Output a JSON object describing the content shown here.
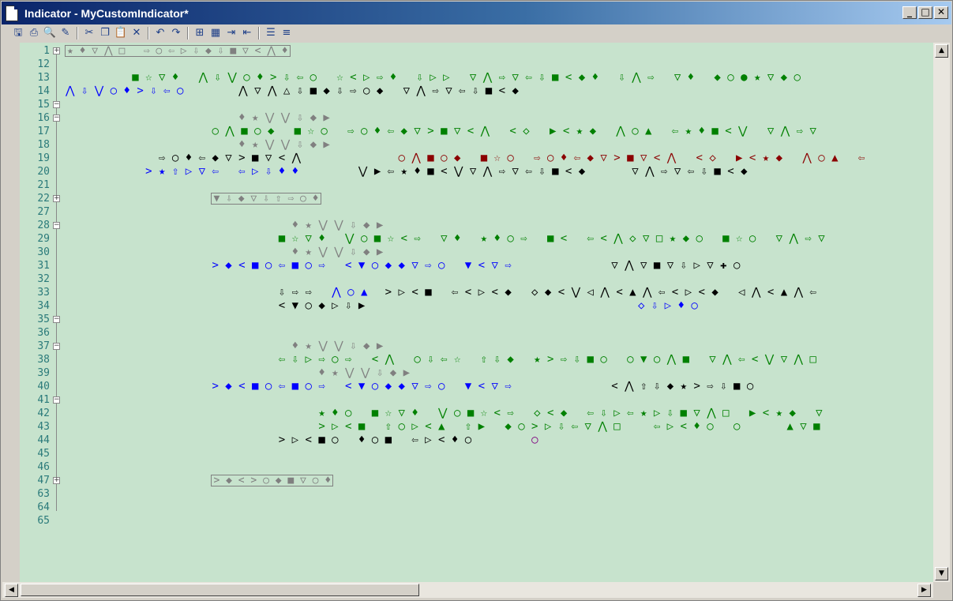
{
  "window": {
    "title": "Indicator - MyCustomIndicator*"
  },
  "window_buttons": [
    "_",
    "□",
    "✕"
  ],
  "toolbar": {
    "groups": [
      [
        "save-icon",
        "print-icon",
        "print-preview-icon",
        "find-icon"
      ],
      [
        "cut-icon",
        "copy-icon",
        "paste-icon",
        "delete-icon"
      ],
      [
        "undo-icon",
        "redo-icon"
      ],
      [
        "binoculars-icon",
        "replace-icon",
        "indent-icon",
        "outdent-icon"
      ],
      [
        "comment-icon",
        "uncomment-icon"
      ]
    ],
    "glyphs": {
      "save-icon": "🖫",
      "print-icon": "⎙",
      "print-preview-icon": "🔍",
      "find-icon": "✎",
      "cut-icon": "✂",
      "copy-icon": "❐",
      "paste-icon": "📋",
      "delete-icon": "✕",
      "undo-icon": "↶",
      "redo-icon": "↷",
      "binoculars-icon": "⊞",
      "replace-icon": "▦",
      "indent-icon": "⇥",
      "outdent-icon": "⇤",
      "comment-icon": "☰",
      "uncomment-icon": "≡"
    }
  },
  "editor": {
    "line_numbers": [
      "1",
      "12",
      "13",
      "14",
      "15",
      "16",
      "17",
      "18",
      "19",
      "20",
      "21",
      "22",
      "27",
      "28",
      "29",
      "30",
      "31",
      "32",
      "33",
      "34",
      "35",
      "36",
      "37",
      "38",
      "39",
      "40",
      "41",
      "42",
      "43",
      "44",
      "45",
      "46",
      "47",
      "63",
      "64",
      "65"
    ],
    "lines": [
      {
        "ln": "1",
        "collapsed": true,
        "text": "★ ♦ ▽ ⋀ □   ⇨ ○ ⇦ ▷ ⇩ ◆ ⇩ ■ ▽ < ⋀ ♦",
        "indent": 0
      },
      {
        "ln": "12",
        "segments": []
      },
      {
        "ln": "13",
        "segments": [
          {
            "col": 5,
            "color": "green",
            "text": "■ ☆ ▽ ♦   ⋀ ⇩ ⋁ ○ ♦ > ⇩ ⇦ ○   ☆ < ▷ ⇨ ♦   ⇩ ▷ ▷   ▽ ⋀ ⇨ ▽ ⇦ ⇩ ■ < ◆ ♦   ⇩ ⋀ ⇨   ▽ ♦   ◆ ○ ● ★ ▽ ◆ ○"
          }
        ]
      },
      {
        "ln": "14",
        "segments": [
          {
            "col": 0,
            "color": "blue",
            "text": "⋀ ⇩ ⋁ ○ ♦ > ⇩ ⇦ ○"
          },
          {
            "col": 13,
            "color": "black",
            "text": "⋀ ▽ ⋀ △ ⇩ ■ ◆ ⇩ ⇨ ○ ◆   ▽ ⋀ ⇨ ▽ ⇦ ⇩ ■ < ◆"
          }
        ]
      },
      {
        "ln": "15",
        "segments": []
      },
      {
        "ln": "16",
        "segments": [
          {
            "col": 13,
            "color": "gray",
            "text": "♦ ★ ⋁ ⋁ ⇩ ◆ ▶"
          }
        ]
      },
      {
        "ln": "17",
        "segments": [
          {
            "col": 11,
            "color": "green",
            "text": "○ ⋀ ■ ○ ◆   ■ ☆ ○   ⇨ ○ ♦ ⇦ ◆ ▽ > ■ ▽ < ⋀   < ◇   ▶ < ★ ◆   ⋀ ○ ▲   ⇦ ★ ♦ ■ < ⋁   ▽ ⋀ ⇨ ▽"
          }
        ]
      },
      {
        "ln": "18",
        "segments": [
          {
            "col": 13,
            "color": "gray",
            "text": "♦ ★ ⋁ ⋁ ⇩ ◆ ▶"
          }
        ]
      },
      {
        "ln": "19",
        "segments": [
          {
            "col": 7,
            "color": "black",
            "text": "⇨ ○ ♦ ⇦ ◆ ▽ > ■ ▽ < ⋀"
          },
          {
            "col": 25,
            "color": "red",
            "text": "○ ⋀ ■ ○ ◆   ■ ☆ ○   ⇨ ○ ♦ ⇦ ◆ ▽ > ■ ▽ < ⋀   < ◇   ▶ < ★ ◆   ⋀ ○ ▲   ⇦"
          }
        ]
      },
      {
        "ln": "20",
        "segments": [
          {
            "col": 6,
            "color": "blue",
            "text": "> ★ ⇧ ▷ ▽ ⇦   ⇦ ▷ ⇩ ♦ ♦"
          },
          {
            "col": 22,
            "color": "black",
            "text": "⋁ ▶ ⇦ ★ ♦ ■ < ⋁ ▽ ⋀ ⇨ ▽ ⇦ ⇩ ■ < ◆       ▽ ⋀ ⇨ ▽ ⇦ ⇩ ■ < ◆"
          }
        ]
      },
      {
        "ln": "21",
        "segments": []
      },
      {
        "ln": "22",
        "collapsed": true,
        "text": "▼ ⇩ ◆ ▽ ⇩ ⇧ ⇨ ○ ♦",
        "indent": 11
      },
      {
        "ln": "27",
        "segments": []
      },
      {
        "ln": "28",
        "segments": [
          {
            "col": 17,
            "color": "gray",
            "text": "♦ ★ ⋁ ⋁ ⇩ ◆ ▶"
          }
        ]
      },
      {
        "ln": "29",
        "segments": [
          {
            "col": 16,
            "color": "green",
            "text": "■ ☆ ▽ ♦   ⋁ ○ ■ ☆ < ⇨   ▽ ♦   ★ ♦ ○ ⇨   ■ <   ⇦ < ⋀ ◇ ▽ □ ★ ◆ ○   ■ ☆ ○   ▽ ⋀ ⇨ ▽"
          }
        ]
      },
      {
        "ln": "30",
        "segments": [
          {
            "col": 17,
            "color": "gray",
            "text": "♦ ★ ⋁ ⋁ ⇩ ◆ ▶"
          }
        ]
      },
      {
        "ln": "31",
        "segments": [
          {
            "col": 11,
            "color": "blue",
            "text": "> ◆ < ■ ○ ⇦ ■ ○ ⇨   < ▼ ○ ◆ ◆ ▽ ⇨ ○   ▼ < ▽ ⇨"
          },
          {
            "col": 41,
            "color": "black",
            "text": "▽ ⋀ ▽ ■ ▽ ⇩ ▷ ▽ ✚ ○"
          }
        ]
      },
      {
        "ln": "32",
        "segments": []
      },
      {
        "ln": "33",
        "segments": [
          {
            "col": 16,
            "color": "black",
            "text": "⇩ ⇨ ⇨"
          },
          {
            "col": 20,
            "color": "blue",
            "text": "⋀ ○ ▲"
          },
          {
            "col": 24,
            "color": "black",
            "text": "> ▷ < ■   ⇦ < ▷ < ◆   ◇ ◆ < ⋁ ◁ ⋀ < ▲ ⋀ ⇦ < ▷ < ◆   ◁ ⋀ < ▲ ⋀ ⇦"
          }
        ]
      },
      {
        "ln": "34",
        "segments": [
          {
            "col": 16,
            "color": "black",
            "text": "< ▼ ○ ◆ ▷ ⇩ ▶"
          },
          {
            "col": 43,
            "color": "blue",
            "text": "◇ ⇩ ▷ ♦ ○"
          }
        ]
      },
      {
        "ln": "35",
        "segments": []
      },
      {
        "ln": "36",
        "segments": []
      },
      {
        "ln": "37",
        "segments": [
          {
            "col": 17,
            "color": "gray",
            "text": "♦ ★ ⋁ ⋁ ⇩ ◆ ▶"
          }
        ]
      },
      {
        "ln": "38",
        "segments": [
          {
            "col": 16,
            "color": "green",
            "text": "⇦ ⇩ ▷ ⇨ ○ ⇨   < ⋀   ○ ⇩ ⇦ ☆   ⇧ ⇩ ◆   ★ > ⇨ ⇩ ■ ○   ○ ▼ ○ ⋀ ■   ▽ ⋀ ⇦ < ⋁ ▽ ⋀ □"
          }
        ]
      },
      {
        "ln": "39",
        "segments": [
          {
            "col": 19,
            "color": "gray",
            "text": "♦ ★ ⋁ ⋁ ⇩ ◆ ▶"
          }
        ]
      },
      {
        "ln": "40",
        "segments": [
          {
            "col": 11,
            "color": "blue",
            "text": "> ◆ < ■ ○ ⇦ ■ ○ ⇨   < ▼ ○ ◆ ◆ ▽ ⇨ ○   ▼ < ▽ ⇨"
          },
          {
            "col": 41,
            "color": "black",
            "text": "< ⋀ ⇧ ⇩ ◆ ★ > ⇨ ⇩ ■ ○"
          }
        ]
      },
      {
        "ln": "41",
        "segments": []
      },
      {
        "ln": "42",
        "segments": [
          {
            "col": 19,
            "color": "green",
            "text": "★ ♦ ○   ■ ☆ ▽ ♦   ⋁ ○ ■ ☆ < ⇨   ◇ < ◆   ⇦ ⇩ ▷ ⇦ ★ ▷ ⇩ ■ ▽ ⋀ □   ▶ < ★ ◆   ▽"
          }
        ]
      },
      {
        "ln": "43",
        "segments": [
          {
            "col": 19,
            "color": "green",
            "text": "> ▷ < ■   ⇧ ○ ▷ < ▲   ⇧ ▶   ◆ ○ > ▷ ⇩ ⇦ ▽ ⋀ □     ⇦ ▷ < ♦ ○   ○       ▲ ▽ ■"
          }
        ]
      },
      {
        "ln": "44",
        "segments": [
          {
            "col": 16,
            "color": "black",
            "text": "> ▷ < ■ ○   ♦ ○ ■   ⇦ ▷ < ♦ ○"
          },
          {
            "col": 35,
            "color": "purple",
            "text": "○"
          }
        ]
      },
      {
        "ln": "45",
        "segments": []
      },
      {
        "ln": "46",
        "segments": []
      },
      {
        "ln": "47",
        "collapsed": true,
        "text": "> ◆ < > ○ ◆ ■ ▽ ○ ♦",
        "indent": 11
      },
      {
        "ln": "63",
        "segments": []
      },
      {
        "ln": "64",
        "segments": []
      },
      {
        "ln": "65",
        "segments": []
      }
    ]
  },
  "scroll": {
    "up": "▲",
    "down": "▼",
    "left": "◀",
    "right": "▶"
  },
  "colors": {
    "editor_bg": "#c7e3cd",
    "line_number": "#2a7a7a",
    "title_from": "#0a246a",
    "title_to": "#a6caf0"
  }
}
